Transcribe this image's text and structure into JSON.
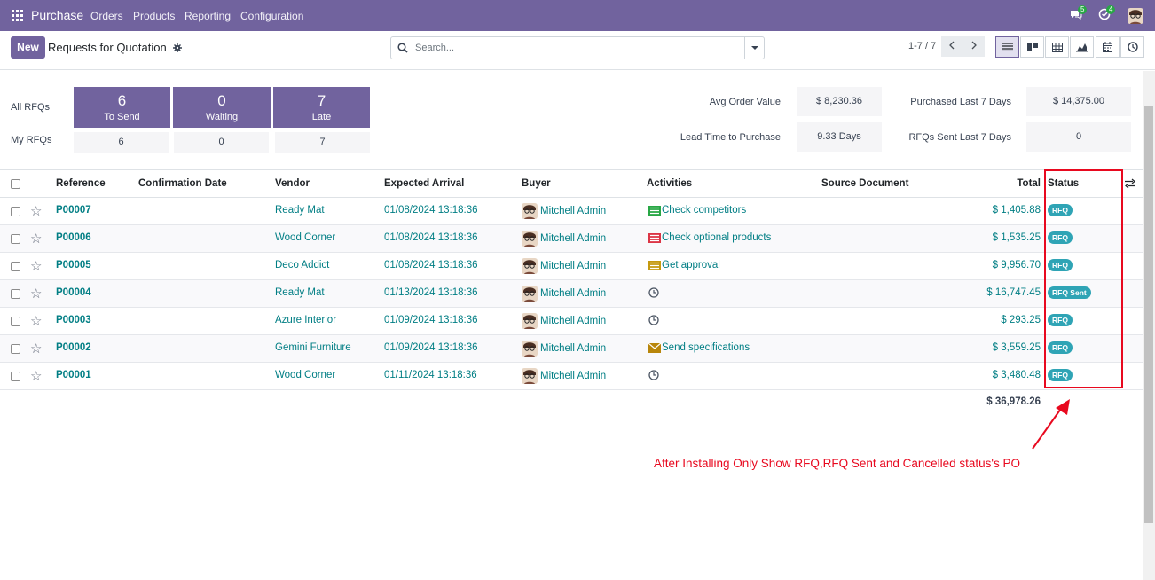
{
  "topbar": {
    "app": "Purchase",
    "menus": [
      "Orders",
      "Products",
      "Reporting",
      "Configuration"
    ],
    "msg_count": "5",
    "activity_count": "4"
  },
  "control": {
    "new_label": "New",
    "title": "Requests for Quotation",
    "search_placeholder": "Search...",
    "pager": "1-7 / 7"
  },
  "dashboard": {
    "all_label": "All RFQs",
    "my_label": "My RFQs",
    "tiles": [
      {
        "value": "6",
        "label": "To Send",
        "mine": "6"
      },
      {
        "value": "0",
        "label": "Waiting",
        "mine": "0"
      },
      {
        "value": "7",
        "label": "Late",
        "mine": "7"
      }
    ],
    "kpis": [
      {
        "label": "Avg Order Value",
        "value": "$ 8,230.36"
      },
      {
        "label": "Purchased Last 7 Days",
        "value": "$ 14,375.00"
      },
      {
        "label": "Lead Time to Purchase",
        "value": "9.33 Days"
      },
      {
        "label": "RFQs Sent Last 7 Days",
        "value": "0"
      }
    ]
  },
  "table": {
    "headers": {
      "reference": "Reference",
      "confirmation": "Confirmation Date",
      "vendor": "Vendor",
      "arrival": "Expected Arrival",
      "buyer": "Buyer",
      "activities": "Activities",
      "source": "Source Document",
      "total": "Total",
      "status": "Status"
    },
    "rows": [
      {
        "ref": "P00007",
        "vendor": "Ready Mat",
        "arrival": "01/08/2024 13:18:36",
        "buyer": "Mitchell Admin",
        "activity": "Check competitors",
        "activity_type": "todo-green",
        "total": "$ 1,405.88",
        "status": "RFQ"
      },
      {
        "ref": "P00006",
        "vendor": "Wood Corner",
        "arrival": "01/08/2024 13:18:36",
        "buyer": "Mitchell Admin",
        "activity": "Check optional products",
        "activity_type": "todo-red",
        "total": "$ 1,535.25",
        "status": "RFQ"
      },
      {
        "ref": "P00005",
        "vendor": "Deco Addict",
        "arrival": "01/08/2024 13:18:36",
        "buyer": "Mitchell Admin",
        "activity": "Get approval",
        "activity_type": "todo-orange",
        "total": "$ 9,956.70",
        "status": "RFQ"
      },
      {
        "ref": "P00004",
        "vendor": "Ready Mat",
        "arrival": "01/13/2024 13:18:36",
        "buyer": "Mitchell Admin",
        "activity": "",
        "activity_type": "clock",
        "total": "$ 16,747.45",
        "status": "RFQ Sent"
      },
      {
        "ref": "P00003",
        "vendor": "Azure Interior",
        "arrival": "01/09/2024 13:18:36",
        "buyer": "Mitchell Admin",
        "activity": "",
        "activity_type": "clock",
        "total": "$ 293.25",
        "status": "RFQ"
      },
      {
        "ref": "P00002",
        "vendor": "Gemini Furniture",
        "arrival": "01/09/2024 13:18:36",
        "buyer": "Mitchell Admin",
        "activity": "Send specifications",
        "activity_type": "email",
        "total": "$ 3,559.25",
        "status": "RFQ"
      },
      {
        "ref": "P00001",
        "vendor": "Wood Corner",
        "arrival": "01/11/2024 13:18:36",
        "buyer": "Mitchell Admin",
        "activity": "",
        "activity_type": "clock",
        "total": "$ 3,480.48",
        "status": "RFQ"
      }
    ],
    "grand_total": "$ 36,978.26"
  },
  "annotation": "After Installing Only Show RFQ,RFQ Sent and Cancelled status's PO",
  "colors": {
    "brand": "#71639e",
    "link": "#017e84",
    "status": "#2fa4b5",
    "annotation": "#e8091f"
  }
}
